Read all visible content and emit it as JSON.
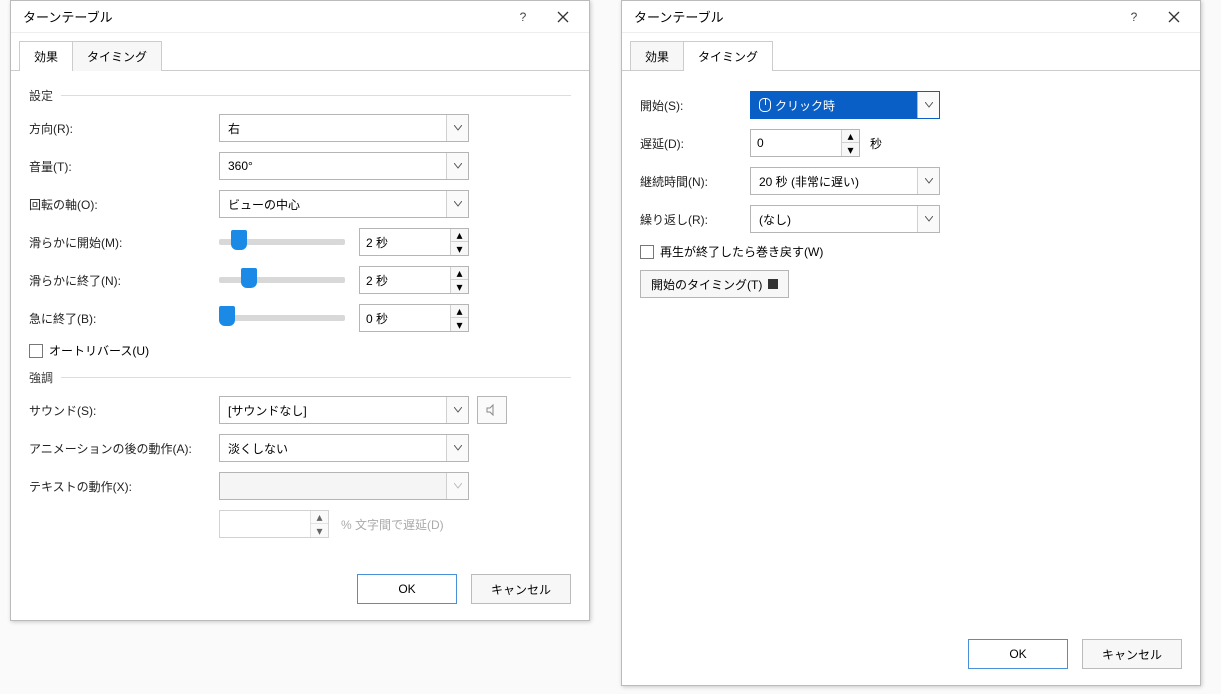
{
  "dialog1": {
    "title": "ターンテーブル",
    "tabs": {
      "effect": "効果",
      "timing": "タイミング"
    },
    "section_settings": "設定",
    "direction_label": "方向(R):",
    "direction_value": "右",
    "volume_label": "音量(T):",
    "volume_value": "360°",
    "axis_label": "回転の軸(O):",
    "axis_value": "ビューの中心",
    "smooth_start_label": "滑らかに開始(M):",
    "smooth_start_value": "2 秒",
    "smooth_end_label": "滑らかに終了(N):",
    "smooth_end_value": "2 秒",
    "bounce_end_label": "急に終了(B):",
    "bounce_end_value": "0 秒",
    "autoreverse_label": "オートリバース(U)",
    "section_emphasis": "強調",
    "sound_label": "サウンド(S):",
    "sound_value": "[サウンドなし]",
    "after_label": "アニメーションの後の動作(A):",
    "after_value": "淡くしない",
    "text_label": "テキストの動作(X):",
    "char_delay_label": "% 文字間で遅延(D)",
    "ok": "OK",
    "cancel": "キャンセル"
  },
  "dialog2": {
    "title": "ターンテーブル",
    "tabs": {
      "effect": "効果",
      "timing": "タイミング"
    },
    "start_label": "開始(S):",
    "start_value": "クリック時",
    "delay_label": "遅延(D):",
    "delay_value": "0",
    "delay_unit": "秒",
    "duration_label": "継続時間(N):",
    "duration_value": "20 秒 (非常に遅い)",
    "repeat_label": "繰り返し(R):",
    "repeat_value": "(なし)",
    "rewind_label": "再生が終了したら巻き戻す(W)",
    "trigger_label": "開始のタイミング(T)",
    "ok": "OK",
    "cancel": "キャンセル"
  }
}
